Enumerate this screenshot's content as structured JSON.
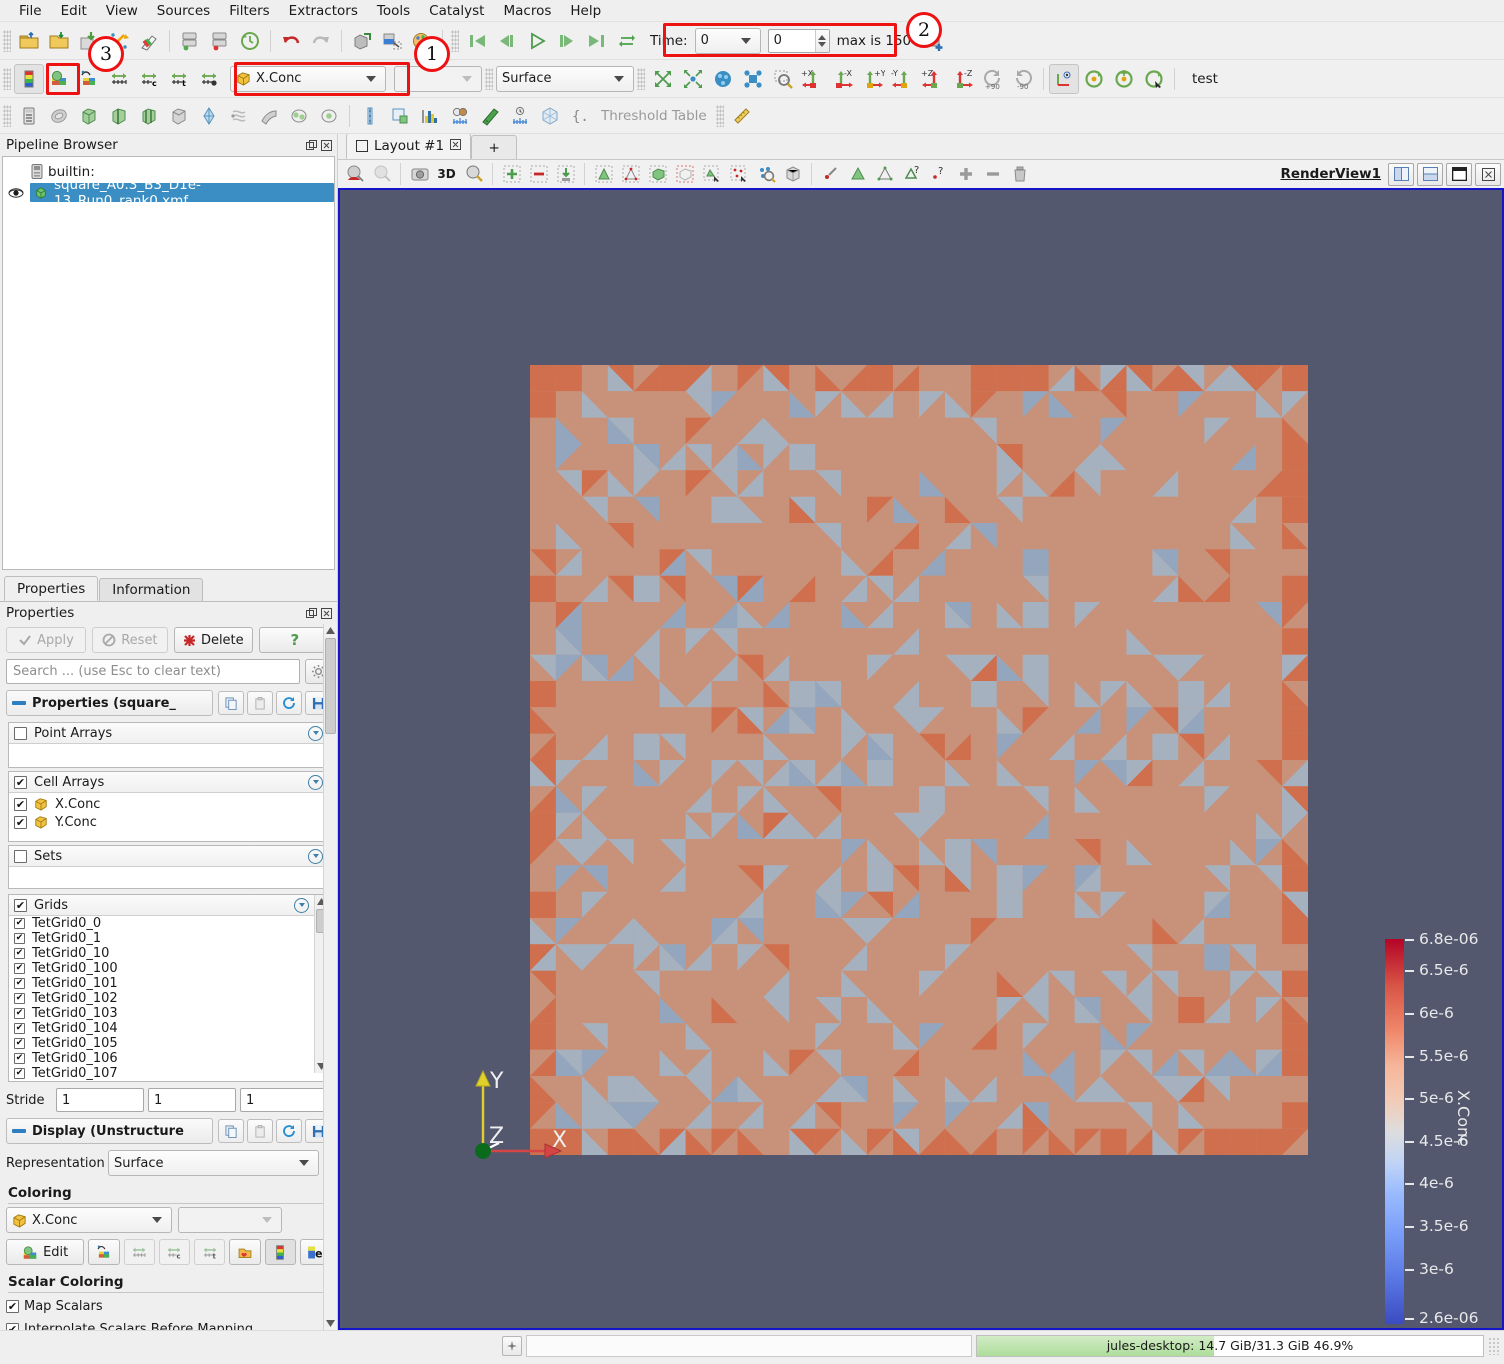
{
  "menu": {
    "items": [
      "File",
      "Edit",
      "View",
      "Sources",
      "Filters",
      "Extractors",
      "Tools",
      "Catalyst",
      "Macros",
      "Help"
    ]
  },
  "toolbar": {
    "time_label": "Time:",
    "time_value": "0",
    "time_step": "0",
    "max_label": "max is 150",
    "array_selector": "X.Conc",
    "representation": "Surface",
    "test_label": "test",
    "threshold_table_label": "Threshold Table"
  },
  "annotations": [
    {
      "id": "1",
      "target": "array-selector"
    },
    {
      "id": "2",
      "target": "time-controls"
    },
    {
      "id": "3",
      "target": "color-map-editor-button"
    }
  ],
  "pipeline": {
    "title": "Pipeline Browser",
    "builtin": "builtin:",
    "source": "square_A0.3_B3_D1e-13_Run0_rank0.xmf"
  },
  "properties": {
    "tabs": [
      "Properties",
      "Information"
    ],
    "active_tab": "Properties",
    "panel_title": "Properties",
    "apply_label": "Apply",
    "reset_label": "Reset",
    "delete_label": "Delete",
    "help_label": "?",
    "search_placeholder": "Search ... (use Esc to clear text)",
    "properties_group": "Properties (square_",
    "point_arrays": {
      "label": "Point Arrays",
      "checked": false,
      "items": []
    },
    "cell_arrays": {
      "label": "Cell Arrays",
      "checked": true,
      "items": [
        {
          "label": "X.Conc",
          "checked": true
        },
        {
          "label": "Y.Conc",
          "checked": true
        }
      ]
    },
    "sets": {
      "label": "Sets",
      "checked": false,
      "items": []
    },
    "grids": {
      "label": "Grids",
      "checked": true,
      "items": [
        {
          "label": "TetGrid0_0",
          "checked": true
        },
        {
          "label": "TetGrid0_1",
          "checked": true
        },
        {
          "label": "TetGrid0_10",
          "checked": true
        },
        {
          "label": "TetGrid0_100",
          "checked": true
        },
        {
          "label": "TetGrid0_101",
          "checked": true
        },
        {
          "label": "TetGrid0_102",
          "checked": true
        },
        {
          "label": "TetGrid0_103",
          "checked": true
        },
        {
          "label": "TetGrid0_104",
          "checked": true
        },
        {
          "label": "TetGrid0_105",
          "checked": true
        },
        {
          "label": "TetGrid0_106",
          "checked": true
        },
        {
          "label": "TetGrid0_107",
          "checked": true
        }
      ]
    },
    "stride": {
      "label": "Stride",
      "values": [
        "1",
        "1",
        "1"
      ]
    },
    "display_group": "Display (Unstructure",
    "representation_label": "Representation",
    "representation_value": "Surface",
    "coloring_label": "Coloring",
    "coloring_value": "X.Conc",
    "coloring_component": "",
    "edit_label": "Edit",
    "scalar_coloring_label": "Scalar Coloring",
    "map_scalars": {
      "label": "Map Scalars",
      "checked": true
    },
    "interpolate_scalars": {
      "label": "Interpolate Scalars Before Mapping",
      "checked": true
    }
  },
  "layout": {
    "tab_label": "Layout #1",
    "add_tab_label": "+",
    "view_name": "RenderView1",
    "mode_3d_label": "3D"
  },
  "legend": {
    "title": "X.Conc",
    "ticks": [
      "6.8e-06",
      "6.5e-6",
      "6e-6",
      "5.5e-6",
      "5e-6",
      "4.5e-6",
      "4e-6",
      "3.5e-6",
      "3e-6",
      "2.6e-06"
    ],
    "tick_positions": [
      0,
      7.9,
      23.7,
      39.5,
      55.3,
      71.0,
      86.8,
      100.0,
      100.0,
      100.0
    ],
    "min": "2.6e-06",
    "max": "6.8e-06",
    "colormap": "cool-to-warm"
  },
  "axes": {
    "x": "X",
    "y": "Y",
    "z": "Z",
    "x_color": "#d64545",
    "y_color": "#e0d02a",
    "z_color": "#ffffff",
    "origin_color": "#0b6b1d"
  },
  "render": {
    "background": "#53586f",
    "mesh_color_warm": "#c8927a",
    "mesh_color_cool": "#a6b1c0"
  },
  "statusbar": {
    "memory": "jules-desktop: 14.7 GiB/31.3 GiB 46.9%",
    "memory_percent": 46.9
  }
}
